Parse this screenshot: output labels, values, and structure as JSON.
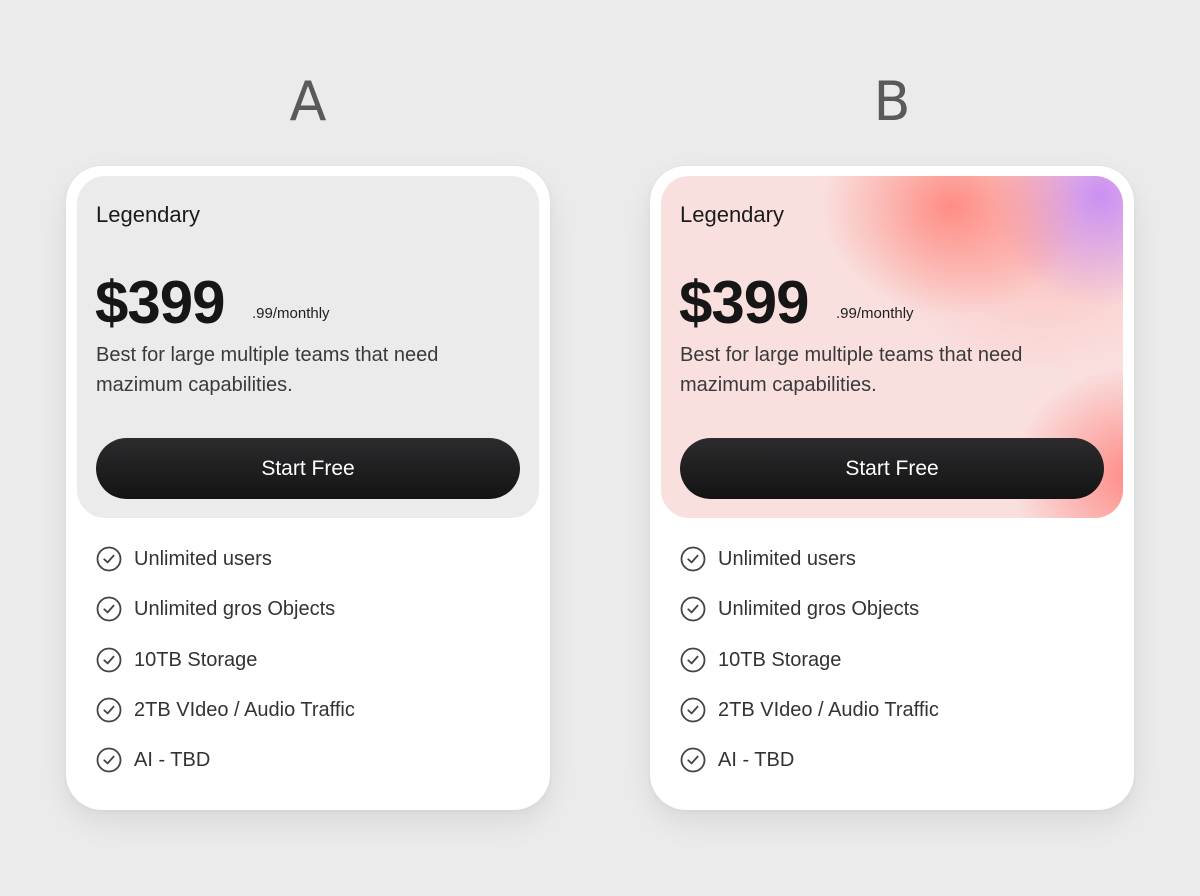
{
  "variants": {
    "a": {
      "label": "A"
    },
    "b": {
      "label": "B"
    }
  },
  "plan": {
    "name": "Legendary",
    "price": "$399",
    "price_suffix": ".99/monthly",
    "description": "Best for large multiple teams that need mazimum capabilities.",
    "cta_label": "Start Free",
    "features": [
      "Unlimited users",
      "Unlimited gros Objects",
      "10TB Storage",
      "2TB VIdeo / Audio Traffic",
      "AI - TBD"
    ]
  },
  "icons": {
    "feature_icon": "check-circle-icon"
  },
  "colors": {
    "background": "#ebebeb",
    "card": "#ffffff",
    "panel_a": "#ebebeb",
    "panel_b_base": "#f9e0df",
    "button": "#1a191a",
    "accent_coral": "#ff8076",
    "accent_purple": "#c88cf5"
  }
}
